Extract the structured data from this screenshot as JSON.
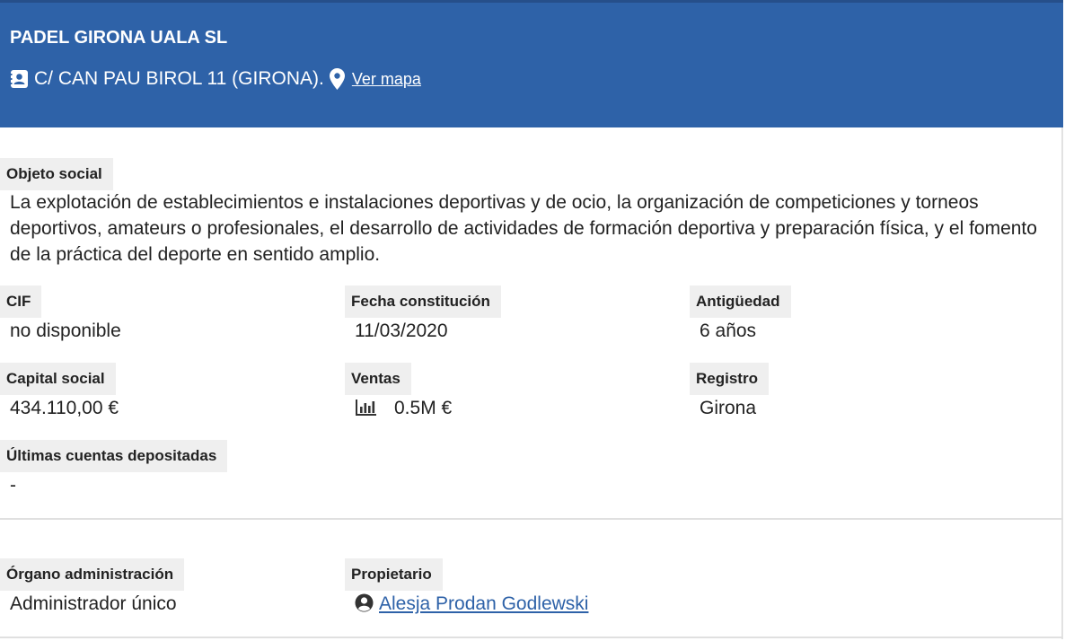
{
  "company": {
    "name": "PADEL GIRONA UALA SL",
    "address": "C/ CAN PAU BIROL 11 (GIRONA).",
    "map_link": "Ver mapa"
  },
  "objeto_social": {
    "label": "Objeto social",
    "value": "La explotación de establecimientos e instalaciones deportivas y de ocio, la organización de competiciones y torneos deportivos, amateurs o profesionales, el desarrollo de actividades de formación deportiva y preparación física, y el fomento de la práctica del deporte en sentido amplio."
  },
  "fields": {
    "cif": {
      "label": "CIF",
      "value": "no disponible"
    },
    "fecha": {
      "label": "Fecha constitución",
      "value": "11/03/2020"
    },
    "antiguedad": {
      "label": "Antigüedad",
      "value": "6 años"
    },
    "capital": {
      "label": "Capital social",
      "value": "434.110,00 €"
    },
    "ventas": {
      "label": "Ventas",
      "value": "0.5M €",
      "icon": "bar-chart-icon"
    },
    "registro": {
      "label": "Registro",
      "value": "Girona"
    },
    "cuentas": {
      "label": "Últimas cuentas depositadas",
      "value": "-"
    }
  },
  "administration": {
    "organo": {
      "label": "Órgano administración",
      "value": "Administrador único"
    },
    "propietario": {
      "label": "Propietario",
      "value": "Alesja Prodan Godlewski",
      "icon": "user-circle-icon"
    }
  },
  "colors": {
    "header_bg": "#2e62a8",
    "label_bg": "#efefef",
    "link": "#2e62a8"
  }
}
